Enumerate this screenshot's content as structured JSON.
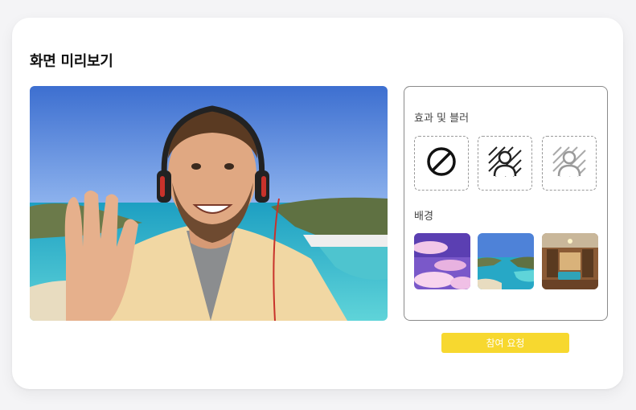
{
  "dialog": {
    "title": "화면 미리보기"
  },
  "effects": {
    "label": "효과 및 블러",
    "items": [
      {
        "name": "none",
        "icon": "no-effect-icon"
      },
      {
        "name": "blur-strong",
        "icon": "blur-strong-icon"
      },
      {
        "name": "blur-light",
        "icon": "blur-light-icon"
      }
    ]
  },
  "backgrounds": {
    "label": "배경",
    "items": [
      {
        "name": "purple-clouds"
      },
      {
        "name": "beach-coast"
      },
      {
        "name": "living-room"
      }
    ]
  },
  "actions": {
    "join_label": "참여 요청"
  },
  "colors": {
    "accent": "#f7d82f",
    "accent_text": "#ffffff",
    "panel_border": "#8a8a8a"
  }
}
